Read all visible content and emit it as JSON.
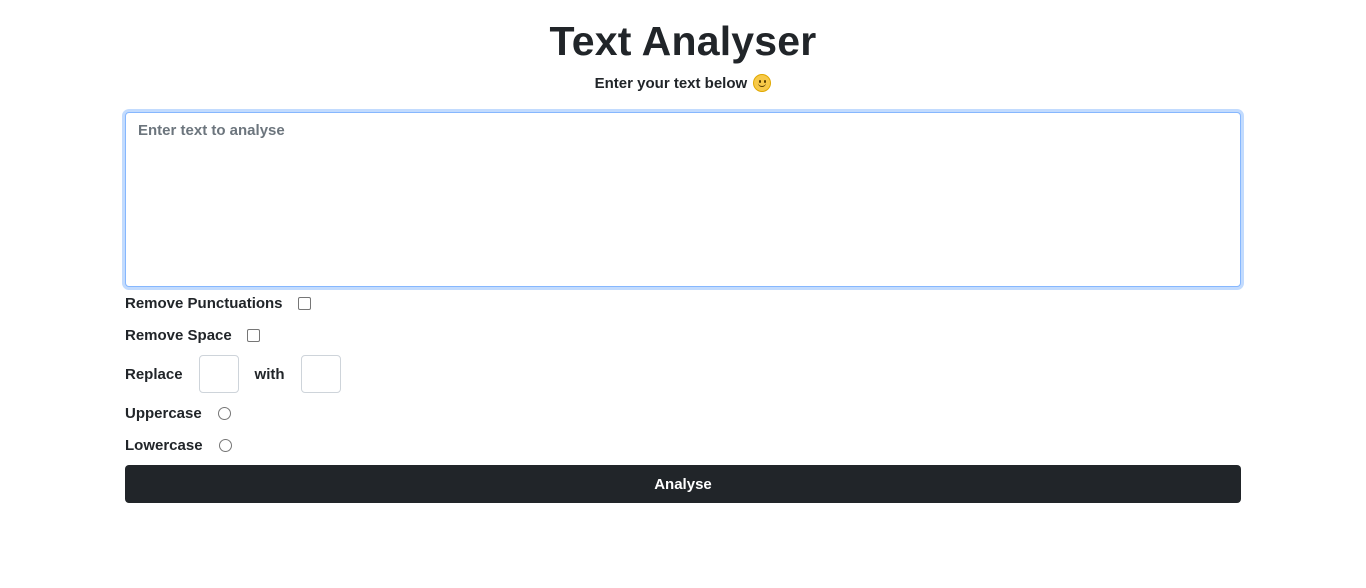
{
  "header": {
    "title": "Text Analyser",
    "subtitle": "Enter your text below",
    "subtitle_icon": "slightly-smiling-face-icon"
  },
  "editor": {
    "placeholder": "Enter text to analyse",
    "value": ""
  },
  "options": {
    "remove_punctuations_label": "Remove Punctuations",
    "remove_punctuations_checked": false,
    "remove_space_label": "Remove Space",
    "remove_space_checked": false,
    "replace_label": "Replace",
    "replace_from_value": "",
    "with_label": "with",
    "replace_to_value": "",
    "uppercase_label": "Uppercase",
    "uppercase_selected": false,
    "lowercase_label": "Lowercase",
    "lowercase_selected": false
  },
  "actions": {
    "analyse_label": "Analyse"
  },
  "colors": {
    "button_bg": "#212529",
    "focus_border": "#86b7fe",
    "placeholder": "#6c757d"
  }
}
